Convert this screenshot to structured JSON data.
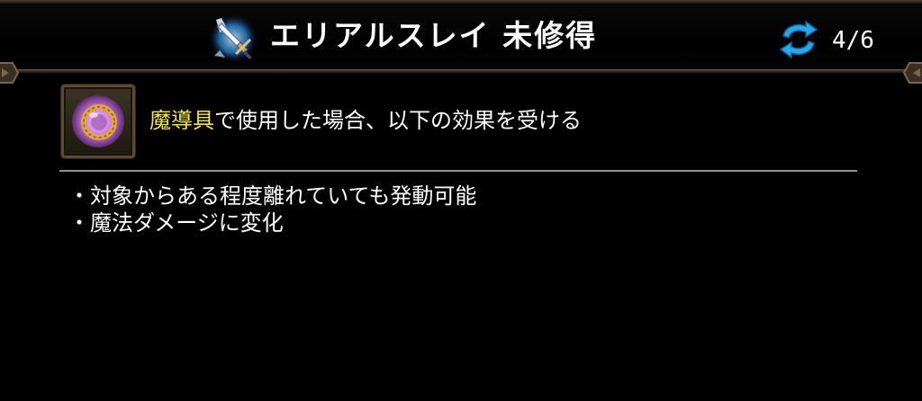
{
  "header": {
    "title": "エリアルスレイ 未修得",
    "page_indicator": "4/6",
    "skill_icon": "sword-skill-icon",
    "cycle_icon": "cycle-arrows-icon"
  },
  "item": {
    "icon": "magic-ring-icon",
    "highlight": "魔導具",
    "description": "で使用した場合、以下の効果を受ける"
  },
  "effects": [
    "・対象からある程度離れていても発動可能",
    "・魔法ダメージに変化"
  ],
  "colors": {
    "background": "#000000",
    "highlight": "#f3e64b",
    "frame": "#6e5a45",
    "divider": "#8f8f8f",
    "cycle_icon": "#2aa7e8"
  }
}
